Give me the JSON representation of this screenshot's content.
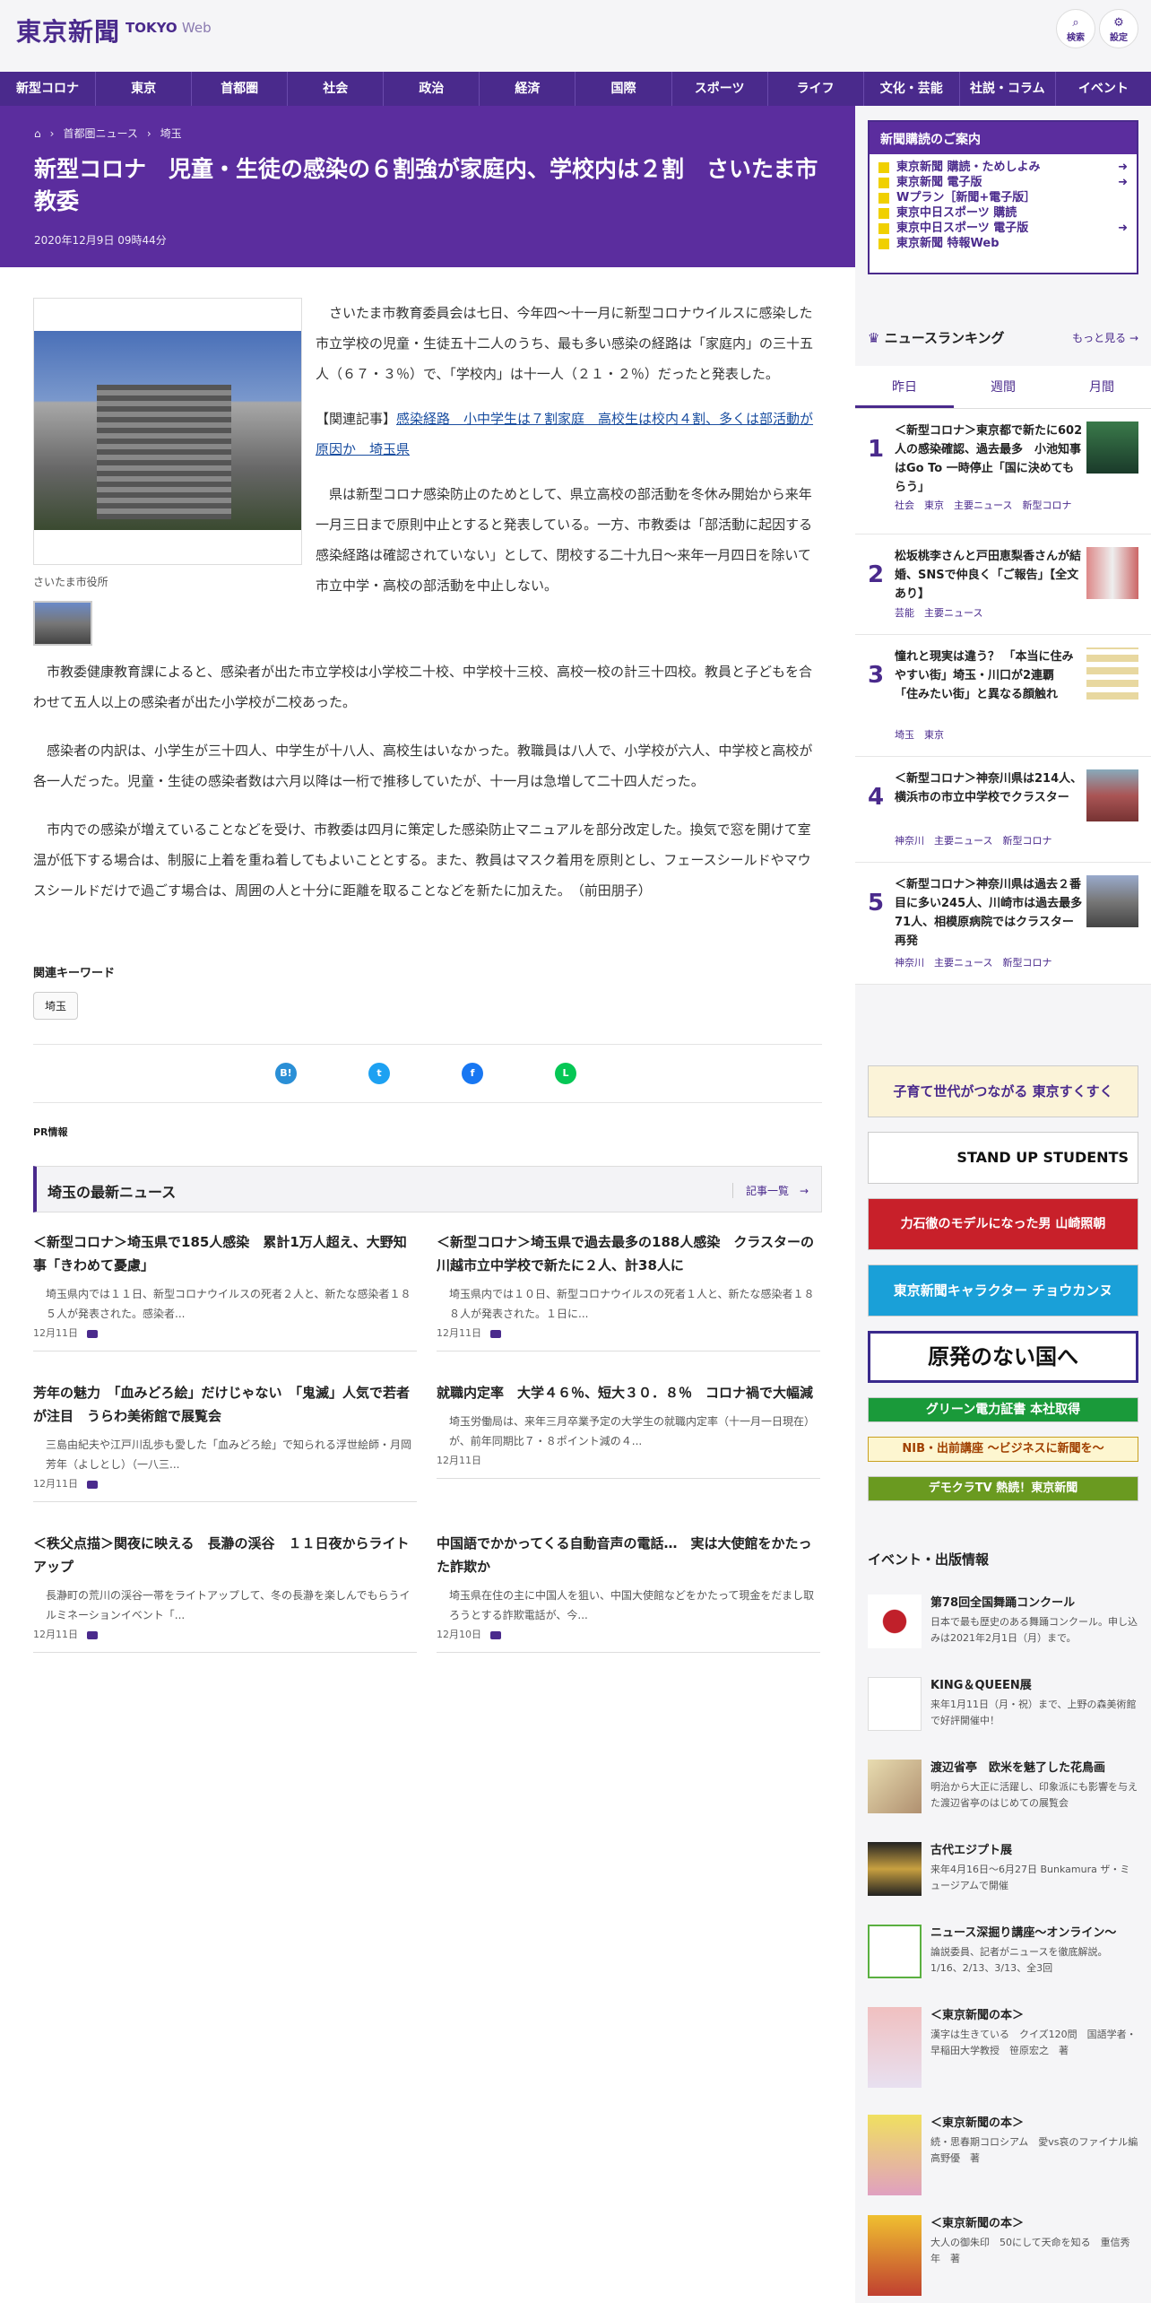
{
  "header": {
    "logo": "東京新聞",
    "logo_en": "TOKYO",
    "logo_web": "Web",
    "search": "検索",
    "settings": "設定"
  },
  "nav": [
    "新型コロナ",
    "東京",
    "首都圏",
    "社会",
    "政治",
    "経済",
    "国際",
    "スポーツ",
    "ライフ",
    "文化・芸能",
    "社説・コラム",
    "イベント"
  ],
  "breadcrumb": {
    "cat": "首都圏ニュース",
    "sub": "埼玉"
  },
  "article": {
    "title": "新型コロナ　児童・生徒の感染の６割強が家庭内、学校内は２割　さいたま市教委",
    "date": "2020年12月9日 09時44分",
    "photo_caption": "さいたま市役所",
    "p1": "さいたま市教育委員会は七日、今年四〜十一月に新型コロナウイルスに感染した市立学校の児童・生徒五十二人のうち、最も多い感染の経路は「家庭内」の三十五人（６７・３％）で、「学校内」は十一人（２１・２％）だったと発表した。",
    "related_label": "【関連記事】",
    "related_link": "感染経路　小中学生は７割家庭　高校生は校内４割、多くは部活動が原因か　埼玉県",
    "p2": "県は新型コロナ感染防止のためとして、県立高校の部活動を冬休み開始から来年一月三日まで原則中止とすると発表している。一方、市教委は「部活動に起因する感染経路は確認されていない」として、閉校する二十九日〜来年一月四日を除いて市立中学・高校の部活動を中止しない。",
    "p3": "市教委健康教育課によると、感染者が出た市立学校は小学校二十校、中学校十三校、高校一校の計三十四校。教員と子どもを合わせて五人以上の感染者が出た小学校が二校あった。",
    "p4": "感染者の内訳は、小学生が三十四人、中学生が十八人、高校生はいなかった。教職員は八人で、小学校が六人、中学校と高校が各一人だった。児童・生徒の感染者数は六月以降は一桁で推移していたが、十一月は急増して二十四人だった。",
    "p5": "市内での感染が増えていることなどを受け、市教委は四月に策定した感染防止マニュアルを部分改定した。換気で窓を開けて室温が低下する場合は、制服に上着を重ね着してもよいこととする。また、教員はマスク着用を原則とし、フェースシールドやマウスシールドだけで過ごす場合は、周囲の人と十分に距離を取ることなどを新たに加えた。　（前田朋子）",
    "keyword_head": "関連キーワード",
    "keyword": "埼玉",
    "pr": "PR情報"
  },
  "share": {
    "hatena": "B!",
    "twitter": "t",
    "facebook": "f",
    "line": "L"
  },
  "latest": {
    "title": "埼玉の最新ニュース",
    "more": "記事一覧　→",
    "items": [
      {
        "title": "＜新型コロナ＞埼玉県で185人感染　累計1万人超え、大野知事「きわめて憂慮」",
        "summary": "埼玉県内では１１日、新型コロナウイルスの死者２人と、新たな感染者１８５人が発表された。感染者...",
        "date": "12月11日"
      },
      {
        "title": "＜新型コロナ＞埼玉県で過去最多の188人感染　クラスターの川越市立中学校で新たに２人、計38人に",
        "summary": "埼玉県内では１０日、新型コロナウイルスの死者１人と、新たな感染者１８８人が発表された。１日に...",
        "date": "12月11日"
      },
      {
        "title": "芳年の魅力　「血みどろ絵」だけじゃない　「鬼滅」人気で若者が注目　うらわ美術館で展覧会",
        "summary": "三島由紀夫や江戸川乱歩も愛した「血みどろ絵」で知られる浮世絵師・月岡芳年（よしとし）（一八三...",
        "date": "12月11日"
      },
      {
        "title": "就職内定率　大学４６％、短大３０．８％　コロナ禍で大幅減",
        "summary": "埼玉労働局は、来年三月卒業予定の大学生の就職内定率（十一月一日現在）が、前年同期比７・８ポイント減の４...",
        "date": "12月11日"
      },
      {
        "title": "＜秩父点描＞関夜に映える　長瀞の渓谷　１１日夜からライトアップ",
        "summary": "長瀞町の荒川の渓谷一帯をライトアップして、冬の長瀞を楽しんでもらうイルミネーションイベント「...",
        "date": "12月11日"
      },
      {
        "title": "中国語でかかってくる自動音声の電話…　実は大使館をかたった詐欺か",
        "summary": "埼玉県在住の主に中国人を狙い、中国大使館などをかたって現金をだまし取ろうとする詐欺電話が、今...",
        "date": "12月10日"
      }
    ]
  },
  "subscribe": {
    "title": "新聞購読のご案内",
    "items": [
      "東京新聞 購読・ためしよみ",
      "東京新聞 電子版",
      "Wプラン［新聞+電子版］",
      "東京中日スポーツ 購読",
      "東京中日スポーツ 電子版",
      "東京新聞 特報Web"
    ]
  },
  "ranking": {
    "title": "ニュースランキング",
    "more": "もっと見る →",
    "tabs": [
      "昨日",
      "週間",
      "月間"
    ],
    "items": [
      {
        "n": "1",
        "title": "＜新型コロナ＞東京都で新たに602人の感染確認、過去最多　小池知事はGo To 一時停止「国に決めてもらう」",
        "tags": "社会　東京　主要ニュース　新型コロナ"
      },
      {
        "n": "2",
        "title": "松坂桃李さんと戸田恵梨香さんが結婚、SNSで仲良く「ご報告」【全文あり】",
        "tags": "芸能　主要ニュース"
      },
      {
        "n": "3",
        "title": "憧れと現実は違う？ 「本当に住みやすい街」埼玉・川口が2連覇　「住みたい街」と異なる顔触れ",
        "tags": "埼玉　東京"
      },
      {
        "n": "4",
        "title": "＜新型コロナ＞神奈川県は214人、横浜市の市立中学校でクラスター",
        "tags": "神奈川　主要ニュース　新型コロナ"
      },
      {
        "n": "5",
        "title": "＜新型コロナ＞神奈川県は過去２番目に多い245人、川崎市は過去最多71人、相模原病院ではクラスター再発",
        "tags": "神奈川　主要ニュース　新型コロナ"
      }
    ]
  },
  "banners": [
    "子育て世代がつながる 東京すくすく",
    "STAND UP STUDENTS",
    "力石徹のモデルになった男 山崎照朝",
    "東京新聞キャラクター チョウカンヌ",
    "原発のない国へ",
    "グリーン電力証書 本社取得",
    "NIB・出前講座 〜ビジネスに新聞を〜",
    "デモクラTV 熱読！東京新聞"
  ],
  "events": {
    "title": "イベント・出版情報",
    "items": [
      {
        "title": "第78回全国舞踊コンクール",
        "sub": "日本で最も歴史のある舞踊コンクール。申し込みは2021年2月1日（月）まで。"
      },
      {
        "title": "KING＆QUEEN展",
        "sub": "来年1月11日（月・祝）まで、上野の森美術館で好評開催中！"
      },
      {
        "title": "渡辺省亭　欧米を魅了した花鳥画",
        "sub": "明治から大正に活躍し、印象派にも影響を与えた渡辺省亭のはじめての展覧会"
      },
      {
        "title": "古代エジプト展",
        "sub": "来年4月16日〜6月27日 Bunkamura ザ・ミュージアムで開催"
      },
      {
        "title": "ニュース深掘り講座～オンライン～",
        "sub": "論説委員、記者がニュースを徹底解説。1/16、2/13、3/13、全3回"
      },
      {
        "title": "＜東京新聞の本＞",
        "sub": "漢字は生きている　クイズ120問　国語学者・早稲田大学教授　笹原宏之　著"
      },
      {
        "title": "＜東京新聞の本＞",
        "sub": "続・思春期コロシアム　愛vs哀のファイナル編　高野優　著"
      },
      {
        "title": "＜東京新聞の本＞",
        "sub": "大人の御朱印　50にして天命を知る　重信秀年　著"
      }
    ]
  }
}
